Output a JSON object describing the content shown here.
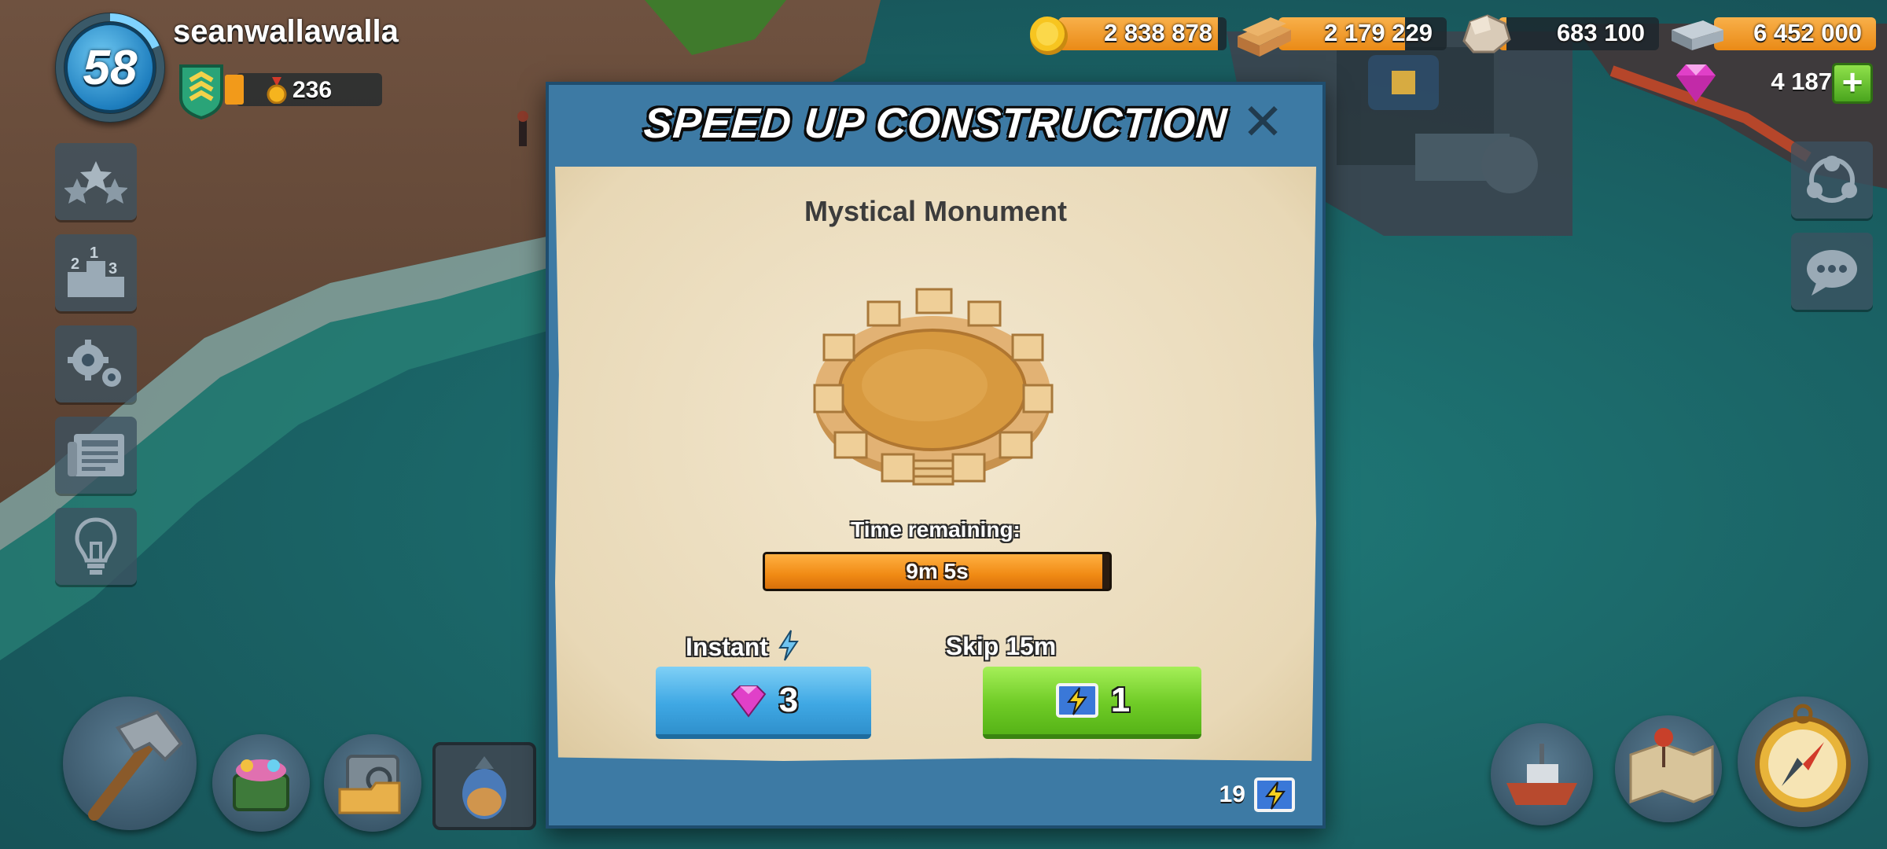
{
  "player": {
    "level": "58",
    "name": "seanwallawalla",
    "medals": "236"
  },
  "resources": [
    {
      "name": "gold",
      "icon": "gold-coin-icon",
      "value": "2 838 878",
      "fill": 0.95,
      "color": "#f5a623"
    },
    {
      "name": "wood",
      "icon": "wood-icon",
      "value": "2 179 229",
      "fill": 0.75,
      "color": "#c8893e"
    },
    {
      "name": "stone",
      "icon": "stone-icon",
      "value": "683 100",
      "fill": 0.05,
      "color": "#d9cbb8"
    },
    {
      "name": "iron",
      "icon": "iron-icon",
      "value": "6 452 000",
      "fill": 1.0,
      "color": "#9aa8b4"
    }
  ],
  "diamonds": "4 187",
  "add_button": "+",
  "side_left": [
    "stars-icon",
    "leaderboard-icon",
    "settings-icon",
    "news-icon",
    "tips-lightbulb-icon"
  ],
  "side_right": [
    "task-force-icon",
    "chat-icon"
  ],
  "modal": {
    "title": "SPEED UP CONSTRUCTION",
    "close": "✕",
    "building_name": "Mystical Monument",
    "time_label": "Time remaining:",
    "time_value": "9m 5s",
    "time_fill": 0.98,
    "instant_label": "Instant",
    "instant_cost": "3",
    "skip_label": "Skip 15m",
    "skip_cost": "1",
    "boost_count": "19"
  },
  "colors": {
    "modal_frame": "#3d7aa4",
    "paper": "#efe2c6",
    "instant_button": "#3fa8e4",
    "skip_button": "#6fcb26",
    "progress": "#f08a14"
  }
}
